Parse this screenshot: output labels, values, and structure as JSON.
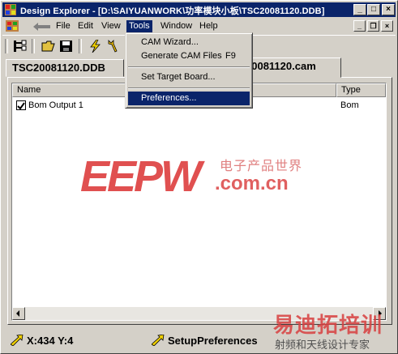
{
  "window": {
    "title": "Design Explorer - [D:\\SAIYUANWORK\\功率模块小板\\TSC20081120.DDB]"
  },
  "menu": {
    "items": [
      {
        "label": "File",
        "active": false
      },
      {
        "label": "Edit",
        "active": false
      },
      {
        "label": "View",
        "active": false
      },
      {
        "label": "Tools",
        "active": true
      },
      {
        "label": "Window",
        "active": false
      },
      {
        "label": "Help",
        "active": false
      }
    ]
  },
  "tools_menu": {
    "items": [
      {
        "label": "CAM Wizard...",
        "shortcut": ""
      },
      {
        "label": "Generate CAM Files",
        "shortcut": "F9"
      },
      {
        "label": "Set Target Board...",
        "shortcut": ""
      },
      {
        "label": "Preferences...",
        "shortcut": "",
        "selected": true
      }
    ]
  },
  "tabs": [
    {
      "label": "TSC20081120.DDB",
      "active": false
    },
    {
      "label": "20081120.cam",
      "active": true
    }
  ],
  "list": {
    "columns": [
      "Name",
      "Type"
    ],
    "rows": [
      {
        "name": "Bom Output 1",
        "type": "Bom",
        "checked": true
      }
    ]
  },
  "status": {
    "coords": "X:434 Y:4",
    "message": "SetupPreferences"
  },
  "watermark": {
    "logo": "EEPW",
    "site": ".com.cn",
    "tagline": "电子产品世界",
    "bottom_logo": "易迪拓培训",
    "bottom_tagline": "射频和天线设计专家"
  },
  "colors": {
    "titlebar": "#0a246a",
    "selection": "#0a246a",
    "face": "#d4d0c8",
    "watermark_red": "#e05050"
  }
}
